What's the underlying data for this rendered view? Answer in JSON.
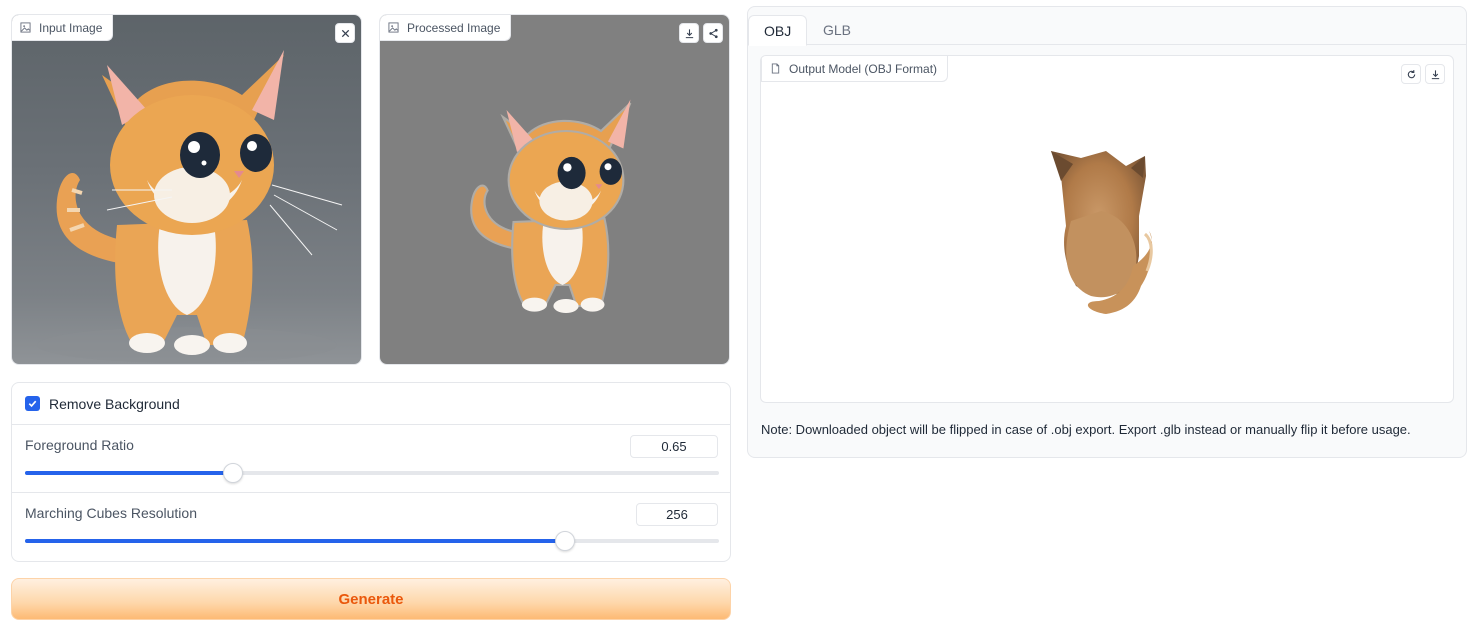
{
  "input_panel": {
    "label": "Input Image",
    "icon": "image-icon",
    "close_icon": "close-icon"
  },
  "processed_panel": {
    "label": "Processed Image",
    "icon": "image-icon",
    "download_icon": "download-icon",
    "share_icon": "share-icon"
  },
  "controls": {
    "remove_background": {
      "label": "Remove Background",
      "checked": true
    },
    "foreground_ratio": {
      "label": "Foreground Ratio",
      "value": "0.65",
      "min": 0.5,
      "max": 1.0
    },
    "mc_resolution": {
      "label": "Marching Cubes Resolution",
      "value": "256",
      "min": 32,
      "max": 320
    }
  },
  "generate_button": {
    "label": "Generate"
  },
  "output": {
    "tabs": [
      {
        "label": "OBJ",
        "active": true
      },
      {
        "label": "GLB",
        "active": false
      }
    ],
    "model_label": "Output Model (OBJ Format)",
    "model_icon": "file-icon",
    "reset_icon": "refresh-icon",
    "download_icon": "download-icon",
    "note": "Note: Downloaded object will be flipped in case of .obj export. Export .glb instead or manually flip it before usage."
  },
  "colors": {
    "accent": "#2563eb",
    "generate_text": "#ea580c",
    "generate_bg": "#fed7aa"
  }
}
